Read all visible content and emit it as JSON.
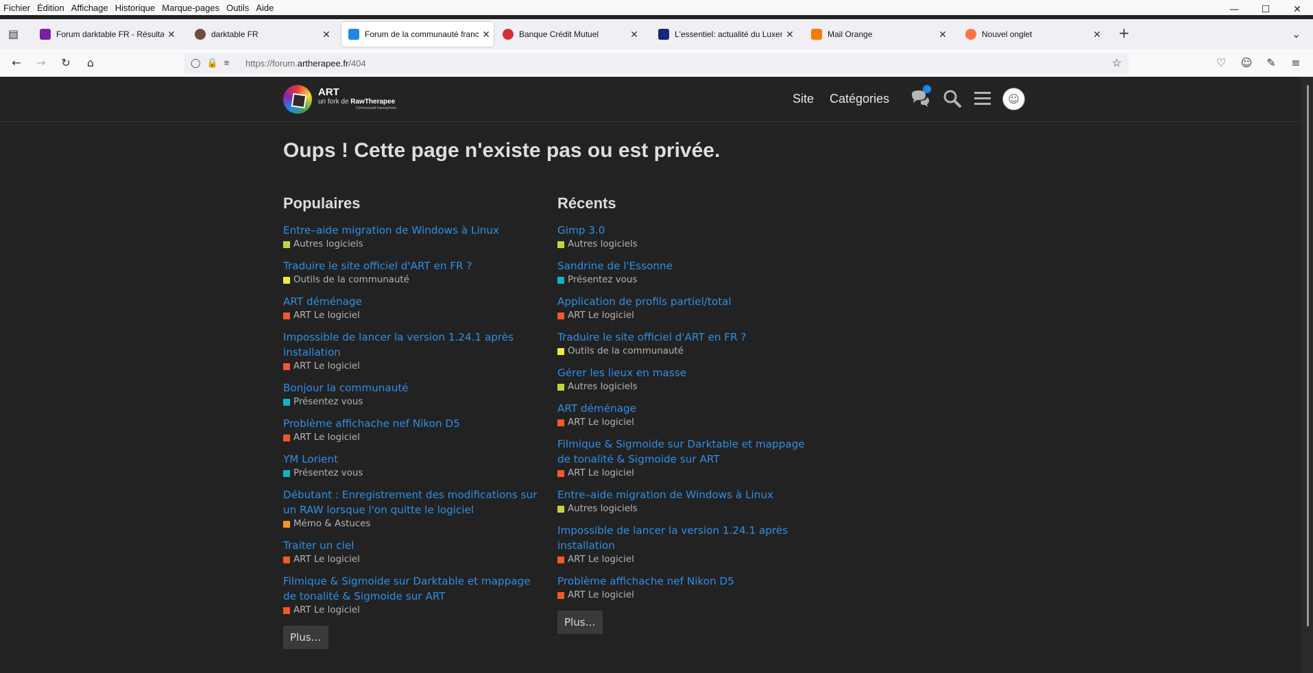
{
  "menubar": [
    "Fichier",
    "Édition",
    "Affichage",
    "Historique",
    "Marque-pages",
    "Outils",
    "Aide"
  ],
  "tabs": [
    {
      "title": "Forum darktable FR - Résultats",
      "favicon_color": "#7b1fa2",
      "active": false
    },
    {
      "title": "darktable FR",
      "favicon_color": "#6d4c41",
      "active": false
    },
    {
      "title": "Forum de la communauté franc",
      "favicon_color": "#1e88e5",
      "active": true
    },
    {
      "title": "Banque Crédit Mutuel",
      "favicon_color": "#d32f2f",
      "active": false
    },
    {
      "title": "L'essentiel: actualité du Luxemb",
      "favicon_color": "#1a237e",
      "active": false
    },
    {
      "title": "Mail Orange",
      "favicon_color": "#f57c00",
      "active": false
    },
    {
      "title": "Nouvel onglet",
      "favicon_color": "#ff7043",
      "active": false
    }
  ],
  "url": {
    "prefix": "https://forum.",
    "domain": "artherapee.fr",
    "path": "/404"
  },
  "site": {
    "logo_title": "ART",
    "logo_sub_prefix": "un fork de ",
    "logo_sub_brand": "RawTherapee",
    "logo_sub2": "Communauté francophone",
    "nav_site": "Site",
    "nav_categories": "Catégories"
  },
  "page_title": "Oups ! Cette page n'existe pas ou est privée.",
  "popular": {
    "heading": "Populaires",
    "topics": [
      {
        "title": "Entre–aide migration de Windows à Linux",
        "category": "Autres logiciels",
        "color": "#c6d43a"
      },
      {
        "title": "Traduire le site officiel d'ART en FR ?",
        "category": "Outils de la communauté",
        "color": "#f3ec39"
      },
      {
        "title": "ART déménage",
        "category": "ART Le logiciel",
        "color": "#f1592a"
      },
      {
        "title": "Impossible de lancer la version 1.24.1 après installation",
        "category": "ART Le logiciel",
        "color": "#f1592a"
      },
      {
        "title": "Bonjour la communauté",
        "category": "Présentez vous",
        "color": "#10b3cc"
      },
      {
        "title": "Problème affichache nef Nikon D5",
        "category": "ART Le logiciel",
        "color": "#f1592a"
      },
      {
        "title": "YM Lorient",
        "category": "Présentez vous",
        "color": "#10b3cc"
      },
      {
        "title": "Débutant : Enregistrement des modifications sur un RAW lorsque l'on quitte le logiciel",
        "category": "Mémo & Astuces",
        "color": "#f7941d"
      },
      {
        "title": "Traiter un ciel",
        "category": "ART Le logiciel",
        "color": "#f1592a"
      },
      {
        "title": "Filmique & Sigmoide sur Darktable et mappage de tonalité & Sigmoide sur ART",
        "category": "ART Le logiciel",
        "color": "#f1592a"
      }
    ],
    "more": "Plus…"
  },
  "recent": {
    "heading": "Récents",
    "topics": [
      {
        "title": "Gimp 3.0",
        "category": "Autres logiciels",
        "color": "#c6d43a"
      },
      {
        "title": "Sandrine de l'Essonne",
        "category": "Présentez vous",
        "color": "#10b3cc"
      },
      {
        "title": "Application de profils partiel/total",
        "category": "ART Le logiciel",
        "color": "#f1592a"
      },
      {
        "title": "Traduire le site officiel d'ART en FR ?",
        "category": "Outils de la communauté",
        "color": "#f3ec39"
      },
      {
        "title": "Gérer les lieux en masse",
        "category": "Autres logiciels",
        "color": "#c6d43a"
      },
      {
        "title": "ART déménage",
        "category": "ART Le logiciel",
        "color": "#f1592a"
      },
      {
        "title": "Filmique & Sigmoide sur Darktable et mappage de tonalité & Sigmoide sur ART",
        "category": "ART Le logiciel",
        "color": "#f1592a"
      },
      {
        "title": "Entre–aide migration de Windows à Linux",
        "category": "Autres logiciels",
        "color": "#c6d43a"
      },
      {
        "title": "Impossible de lancer la version 1.24.1 après installation",
        "category": "ART Le logiciel",
        "color": "#f1592a"
      },
      {
        "title": "Problème affichache nef Nikon D5",
        "category": "ART Le logiciel",
        "color": "#f1592a"
      }
    ],
    "more": "Plus…"
  },
  "colors": {
    "link": "#2f8fe6",
    "background": "#222222",
    "notification": "#1e88e5"
  }
}
